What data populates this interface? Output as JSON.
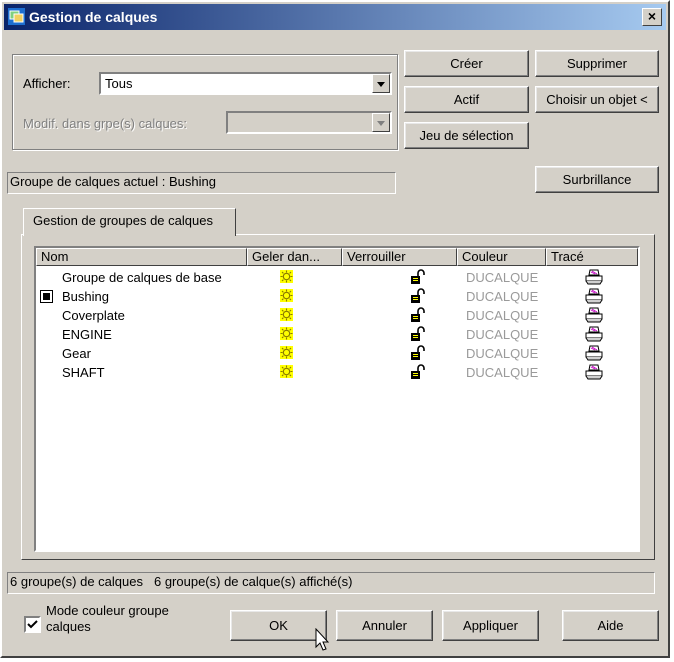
{
  "window": {
    "title": "Gestion de calques",
    "close_glyph": "×",
    "app_icon": "layers-app-icon"
  },
  "filter": {
    "show_label": "Afficher:",
    "show_value": "Tous",
    "modif_label": "Modif. dans grpe(s) calques:",
    "modif_value": ""
  },
  "buttons": {
    "create": "Créer",
    "delete": "Supprimer",
    "active": "Actif",
    "choose_object": "Choisir un objet <",
    "selection_set": "Jeu de sélection",
    "highlight": "Surbrillance",
    "ok": "OK",
    "cancel": "Annuler",
    "apply": "Appliquer",
    "help": "Aide"
  },
  "current_group": "Groupe de calques actuel : Bushing",
  "tab_label": "Gestion de groupes de calques",
  "table": {
    "columns": [
      "Nom",
      "Geler dan...",
      "Verrouiller",
      "Couleur",
      "Tracé"
    ],
    "rows": [
      {
        "name": "Groupe de calques de base",
        "current": false,
        "freeze_icon": "sun-icon",
        "lock_icon": "unlocked-padlock-icon",
        "color": "DUCALQUE",
        "plot_icon": "printer-icon"
      },
      {
        "name": "Bushing",
        "current": true,
        "freeze_icon": "sun-icon",
        "lock_icon": "unlocked-padlock-icon",
        "color": "DUCALQUE",
        "plot_icon": "printer-icon"
      },
      {
        "name": "Coverplate",
        "current": false,
        "freeze_icon": "sun-icon",
        "lock_icon": "unlocked-padlock-icon",
        "color": "DUCALQUE",
        "plot_icon": "printer-icon"
      },
      {
        "name": "ENGINE",
        "current": false,
        "freeze_icon": "sun-icon",
        "lock_icon": "unlocked-padlock-icon",
        "color": "DUCALQUE",
        "plot_icon": "printer-icon"
      },
      {
        "name": "Gear",
        "current": false,
        "freeze_icon": "sun-icon",
        "lock_icon": "unlocked-padlock-icon",
        "color": "DUCALQUE",
        "plot_icon": "printer-icon"
      },
      {
        "name": "SHAFT",
        "current": false,
        "freeze_icon": "sun-icon",
        "lock_icon": "unlocked-padlock-icon",
        "color": "DUCALQUE",
        "plot_icon": "printer-icon"
      }
    ]
  },
  "status": {
    "total": "6 groupe(s) de calques",
    "shown": "6 groupe(s) de calque(s) affiché(s)"
  },
  "options": {
    "color_mode_label_line1": "Mode couleur groupe",
    "color_mode_label_line2": "calques",
    "color_mode_checked": true
  },
  "colors": {
    "title_start": "#0a246a",
    "title_end": "#a6caf0",
    "dialog_face": "#d4d0c8",
    "freeze_sun": "#ffff00",
    "color_text": "#9a9a9a"
  }
}
